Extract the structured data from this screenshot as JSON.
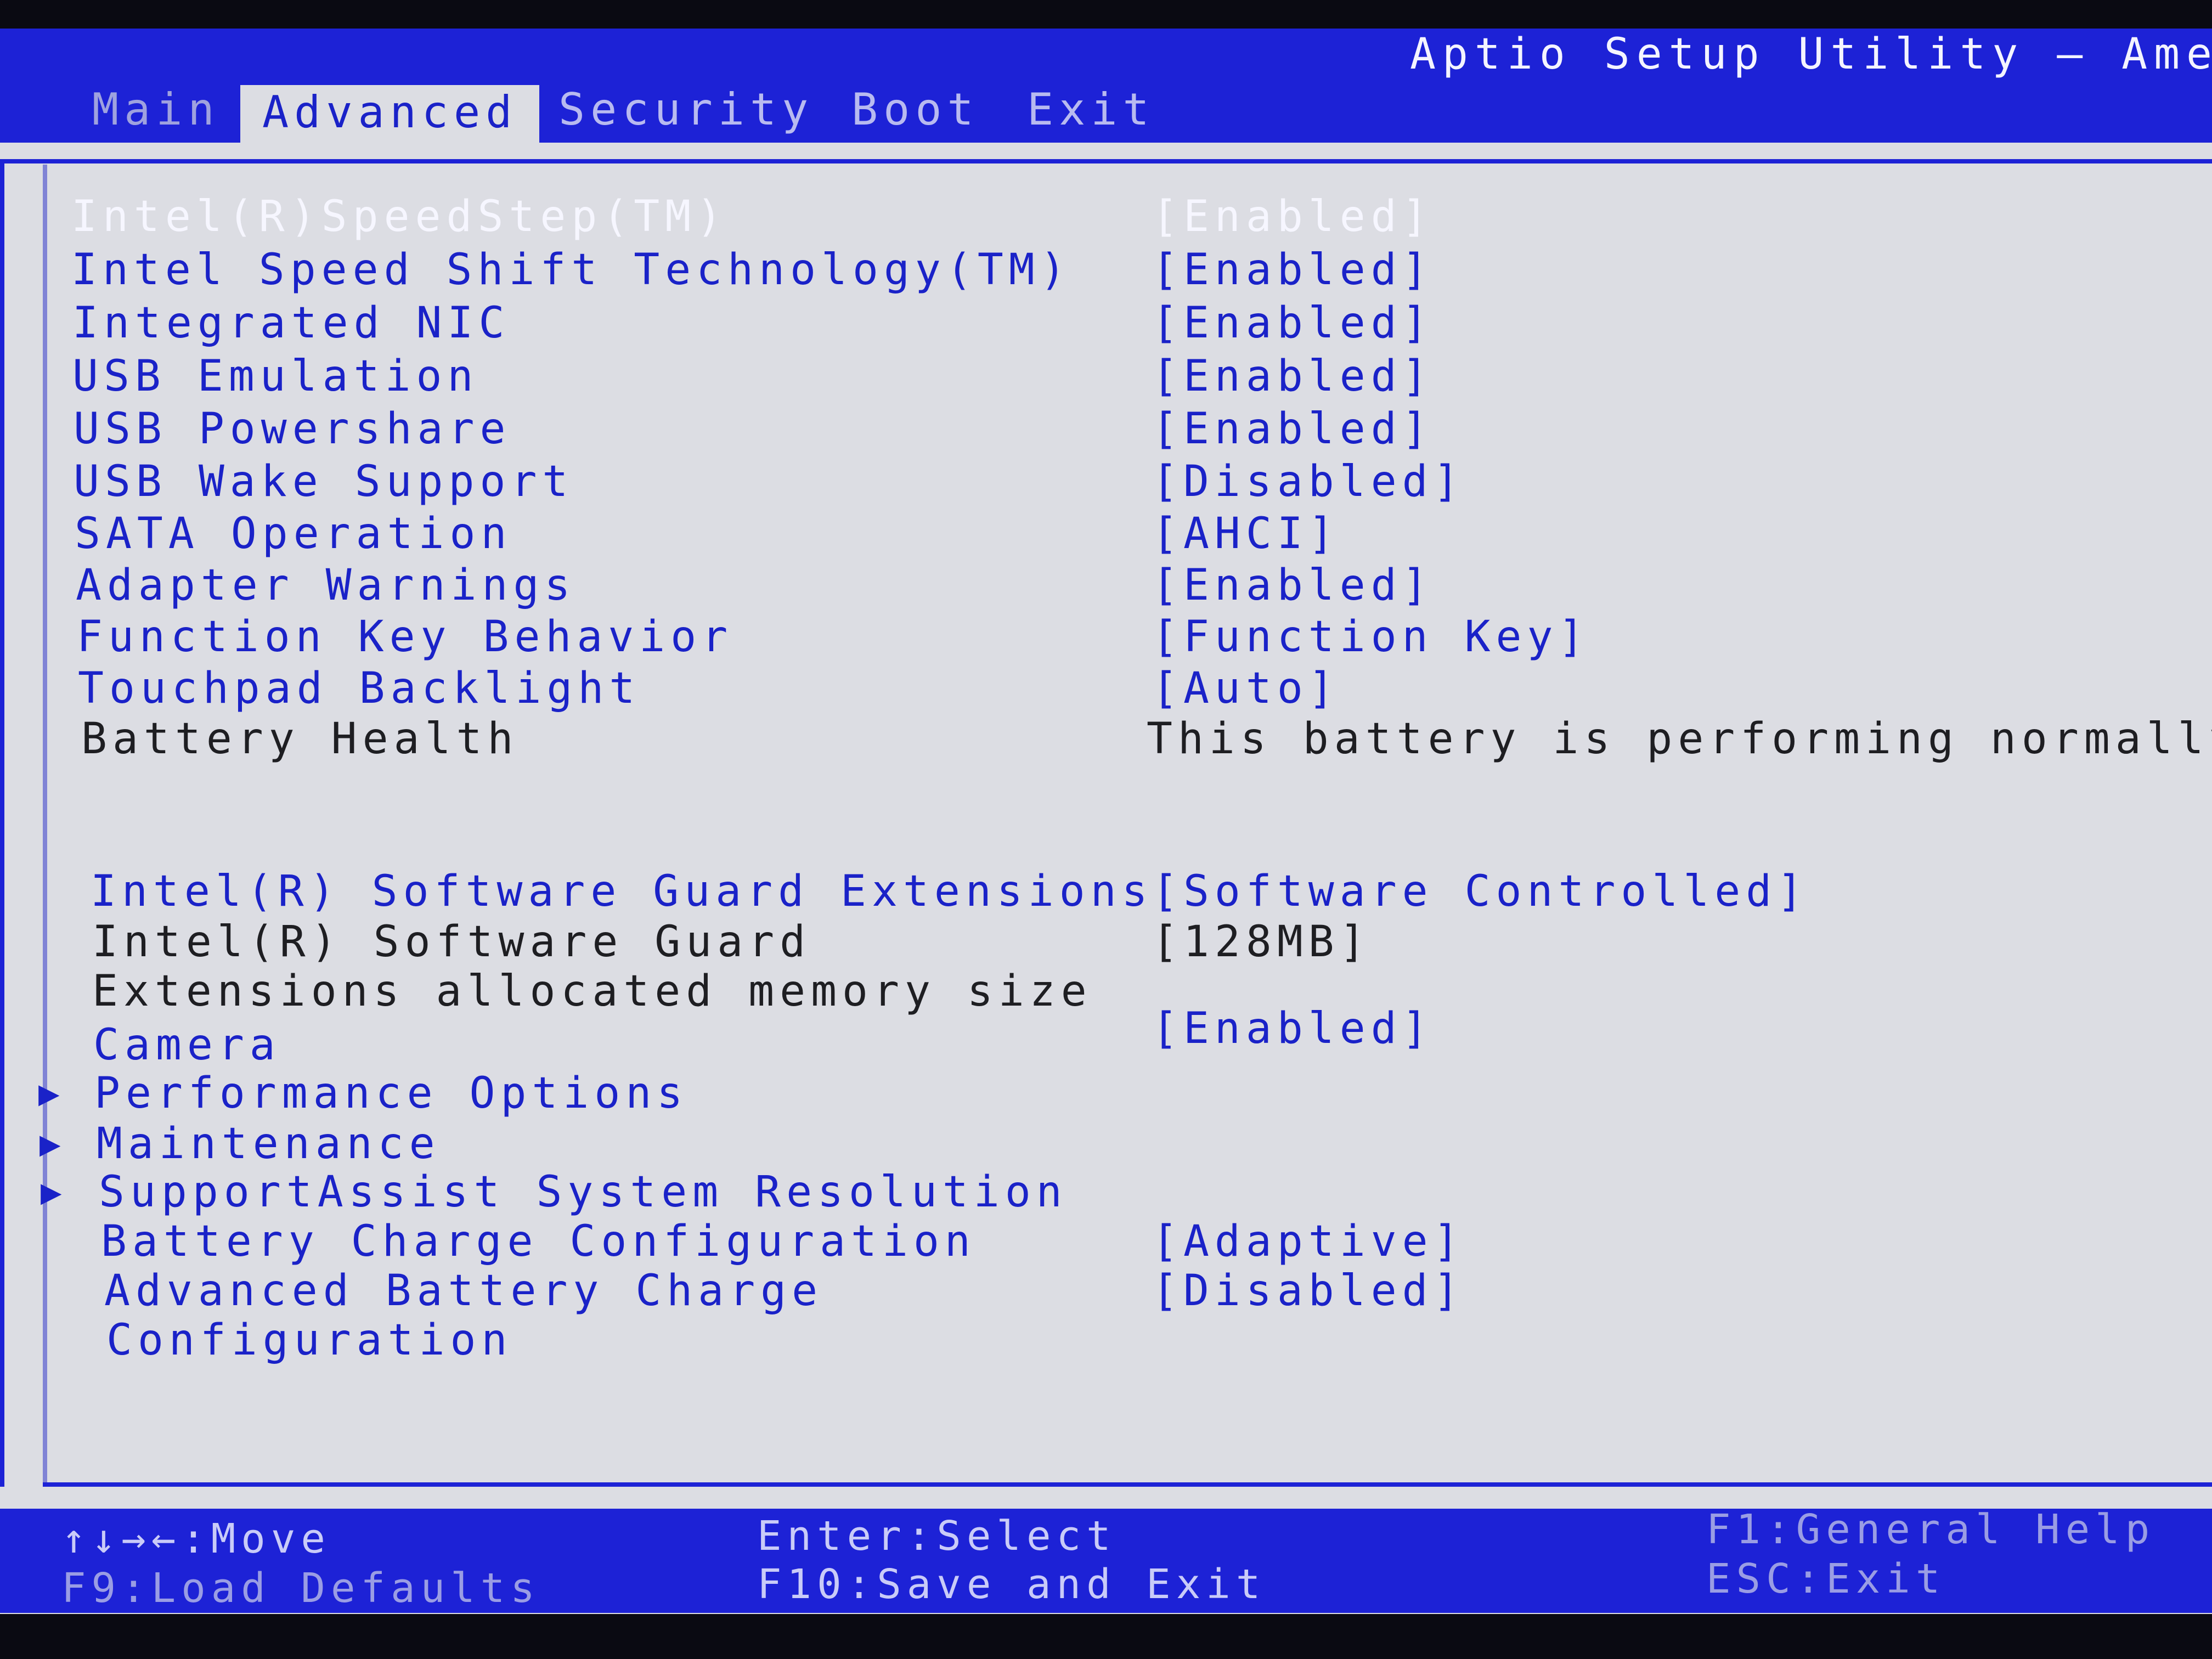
{
  "header": {
    "title": "Aptio Setup Utility – Americ",
    "tabs": [
      "Main",
      "Advanced",
      "Security",
      "Boot",
      "Exit"
    ],
    "active_tab": "Advanced"
  },
  "settings": [
    {
      "label": "Intel(R)SpeedStep(TM)",
      "value": "[Enabled]"
    },
    {
      "label": "Intel Speed Shift Technology(TM)",
      "value": "[Enabled]"
    },
    {
      "label": "Integrated NIC",
      "value": "[Enabled]"
    },
    {
      "label": "USB Emulation",
      "value": "[Enabled]"
    },
    {
      "label": "USB Powershare",
      "value": "[Enabled]"
    },
    {
      "label": "USB Wake Support",
      "value": "[Disabled]"
    },
    {
      "label": "SATA Operation",
      "value": "[AHCI]"
    },
    {
      "label": "Adapter Warnings",
      "value": "[Enabled]"
    },
    {
      "label": "Function Key Behavior",
      "value": "[Function Key]"
    },
    {
      "label": "Touchpad Backlight",
      "value": "[Auto]"
    },
    {
      "label": "Battery Health",
      "value": "This battery is performing normally"
    },
    {
      "label": "Intel(R) Software Guard Extensions",
      "value": "[Software Controlled]"
    },
    {
      "label": "Intel(R) Software Guard",
      "value": "[128MB]"
    },
    {
      "label": "Extensions allocated memory size",
      "value": ""
    },
    {
      "label": "Camera",
      "value": "[Enabled]"
    },
    {
      "label": "Performance Options",
      "value": ""
    },
    {
      "label": "Maintenance",
      "value": ""
    },
    {
      "label": "SupportAssist System Resolution",
      "value": ""
    },
    {
      "label": "Battery Charge Configuration",
      "value": "[Adaptive]"
    },
    {
      "label": "Advanced Battery Charge",
      "value": "[Disabled]"
    },
    {
      "label": "Configuration",
      "value": ""
    }
  ],
  "submenu_arrow": "▶",
  "footer": {
    "move": "↑↓→←:Move",
    "load_defaults": "F9:Load Defaults",
    "select": "Enter:Select",
    "save_exit": "F10:Save and Exit",
    "help": "F1:General Help",
    "exit": "ESC:Exit"
  },
  "colors": {
    "bar": "#1d22d6",
    "panel": "#dcdde3",
    "item": "#1a22c8",
    "static_text": "#1e1e22",
    "selected": "#f6f6ff"
  }
}
